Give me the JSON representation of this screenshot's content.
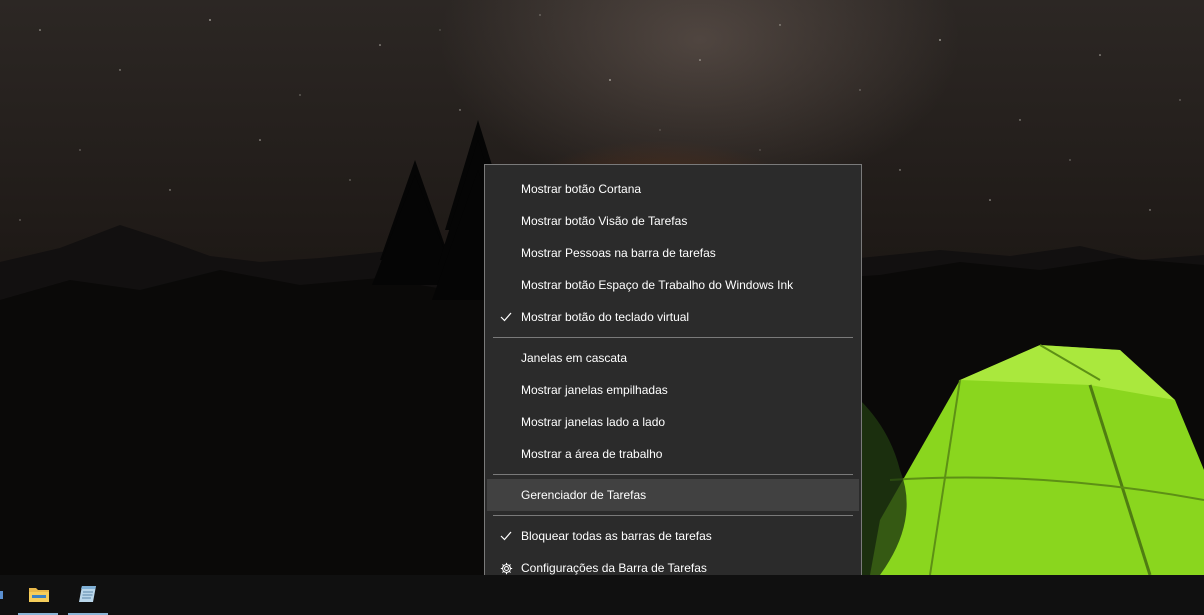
{
  "context_menu": {
    "items": [
      {
        "label": "Mostrar botão Cortana",
        "checked": false
      },
      {
        "label": "Mostrar botão Visão de Tarefas",
        "checked": false
      },
      {
        "label": "Mostrar Pessoas na barra de tarefas",
        "checked": false
      },
      {
        "label": "Mostrar botão Espaço de Trabalho do Windows Ink",
        "checked": false
      },
      {
        "label": "Mostrar botão do teclado virtual",
        "checked": true
      },
      {
        "label": "Janelas em cascata",
        "checked": false
      },
      {
        "label": "Mostrar janelas empilhadas",
        "checked": false
      },
      {
        "label": "Mostrar janelas lado a lado",
        "checked": false
      },
      {
        "label": "Mostrar a área de trabalho",
        "checked": false
      },
      {
        "label": "Gerenciador de Tarefas",
        "checked": false,
        "highlighted": true
      },
      {
        "label": "Bloquear todas as barras de tarefas",
        "checked": true
      },
      {
        "label": "Configurações da Barra de Tarefas",
        "icon": "gear-icon"
      }
    ]
  },
  "taskbar": {
    "pinned": [
      {
        "icon": "file-explorer-icon"
      },
      {
        "icon": "notepad-icon"
      }
    ]
  },
  "colors": {
    "menu_background": "#2b2b2b",
    "menu_highlight": "#414141",
    "menu_border": "#7a7a7a",
    "taskbar": "#101010",
    "tent": "#8ad61e"
  }
}
